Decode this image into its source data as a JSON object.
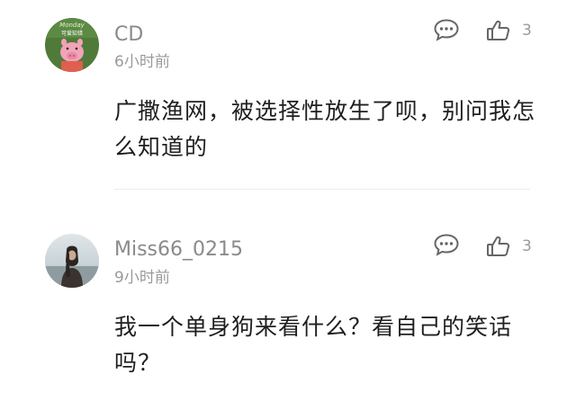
{
  "comments": [
    {
      "username": "CD",
      "avatar_text": "Monday",
      "avatar_subtext": "可爱知错",
      "time": "6小时前",
      "likes": "3",
      "content": "广撒渔网，被选择性放生了呗，别问我怎么知道的"
    },
    {
      "username": "Miss66_0215",
      "time": "9小时前",
      "likes": "3",
      "content": "我一个单身狗来看什么？看自己的笑话吗？"
    }
  ],
  "icons": {
    "reply": "comment-bubble-icon",
    "like": "thumbs-up-icon"
  },
  "colors": {
    "username": "#8a8a8a",
    "content": "#1f1f1f",
    "meta": "#9a9a9a",
    "divider": "#ececec"
  }
}
